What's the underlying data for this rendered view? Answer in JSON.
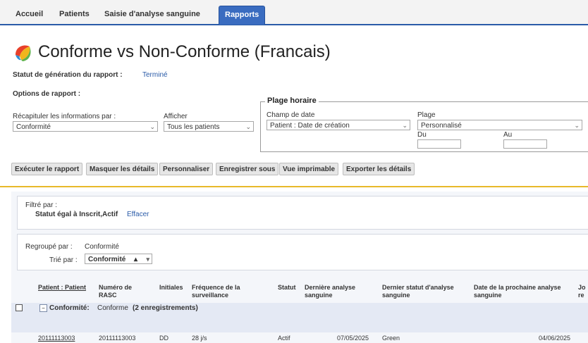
{
  "tabs": [
    "Accueil",
    "Patients",
    "Saisie d'analyse sanguine",
    "Rapports"
  ],
  "page": {
    "title": "Conforme vs Non-Conforme (Francais)"
  },
  "status": {
    "label": "Statut de génération du rapport :",
    "value": "Terminé"
  },
  "options": {
    "title": "Options de rapport :",
    "summarize_label": "Récapituler les informations par :",
    "summarize_value": "Conformité",
    "show_label": "Afficher",
    "show_value": "Tous les patients"
  },
  "time_range": {
    "legend": "Plage horaire",
    "date_field_label": "Champ de date",
    "date_field_value": "Patient : Date de création",
    "range_label": "Plage",
    "range_value": "Personnalisé",
    "from_label": "Du",
    "to_label": "Au"
  },
  "buttons": [
    "Exécuter le rapport",
    "Masquer les détails",
    "Personnaliser",
    "Enregistrer sous",
    "Vue imprimable",
    "Exporter les détails"
  ],
  "filter": {
    "label": "Filtré par :",
    "text": "Statut égal à Inscrit,Actif",
    "clear": "Effacer"
  },
  "grouping": {
    "group_label": "Regroupé par :",
    "group_value": "Conformité",
    "sort_label": "Trié par :",
    "sort_value": "Conformité"
  },
  "table": {
    "headers": [
      "Patient : Patient",
      "Numéro de RASC",
      "Initiales",
      "Fréquence de la surveillance",
      "Statut",
      "Dernière analyse sanguine",
      "Dernier statut d'analyse sanguine",
      "Date de la prochaine analyse sanguine",
      "Jo re"
    ],
    "group_row": {
      "prefix": "Conformité:",
      "value": "Conforme",
      "count": "(2 enregistrements)"
    },
    "rows": [
      {
        "patient": "20111113003",
        "rasc": "20111113003",
        "initials": "DD",
        "frequency": "28 j/s",
        "status": "Actif",
        "last_date": "07/05/2025",
        "last_status": "Green",
        "next_date": "04/06/2025"
      }
    ]
  },
  "colors": {
    "tab_active": "#3a6cc0",
    "accent_line": "#e8b92a",
    "link": "#2a5ba8"
  }
}
